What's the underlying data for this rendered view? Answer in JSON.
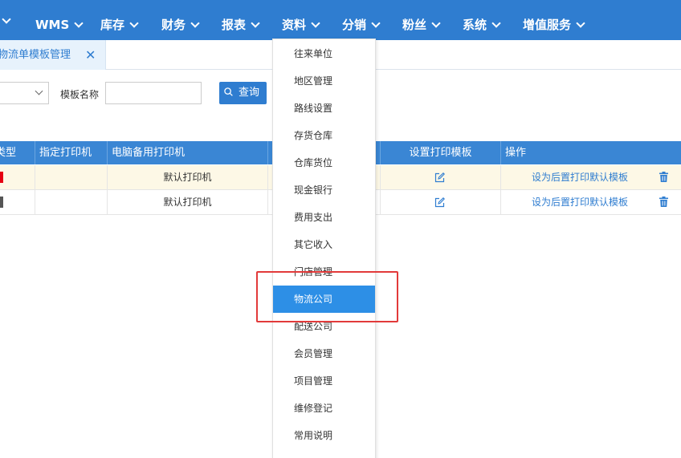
{
  "topnav": {
    "items": [
      {
        "label": "WMS"
      },
      {
        "label": "库存"
      },
      {
        "label": "财务"
      },
      {
        "label": "报表"
      },
      {
        "label": "资料"
      },
      {
        "label": "分销"
      },
      {
        "label": "粉丝"
      },
      {
        "label": "系统"
      },
      {
        "label": "增值服务"
      }
    ]
  },
  "tabs": {
    "active_label": "物流单模板管理",
    "close_glyph": "✕"
  },
  "filter": {
    "name_label": "模板名称",
    "name_value": "",
    "query_label": "查询"
  },
  "table": {
    "headers": {
      "type": "类型",
      "printer": "指定打印机",
      "backup_printer": "电脑备用打印机",
      "template": "设置打印模板",
      "actions": "操作"
    },
    "rows": [
      {
        "marker_color": "#e60012",
        "backup_printer": "默认打印机",
        "action_link": "设为后置打印默认模板"
      },
      {
        "marker_color": "#555555",
        "backup_printer": "默认打印机",
        "action_link": "设为后置打印默认模板"
      }
    ]
  },
  "dropdown": {
    "items": [
      {
        "label": "往来单位"
      },
      {
        "label": "地区管理"
      },
      {
        "label": "路线设置"
      },
      {
        "label": "存货仓库"
      },
      {
        "label": "仓库货位"
      },
      {
        "label": "现金银行"
      },
      {
        "label": "费用支出"
      },
      {
        "label": "其它收入"
      },
      {
        "label": "门店管理"
      },
      {
        "label": "物流公司"
      },
      {
        "label": "配送公司"
      },
      {
        "label": "会员管理"
      },
      {
        "label": "项目管理"
      },
      {
        "label": "维修登记"
      },
      {
        "label": "常用说明"
      }
    ],
    "active_index": 9
  },
  "colors": {
    "nav_bg": "#2f7dd0",
    "header_bg": "#3a86d4",
    "active_item_bg": "#2d8fe6",
    "highlight_border": "#e23a3a"
  }
}
